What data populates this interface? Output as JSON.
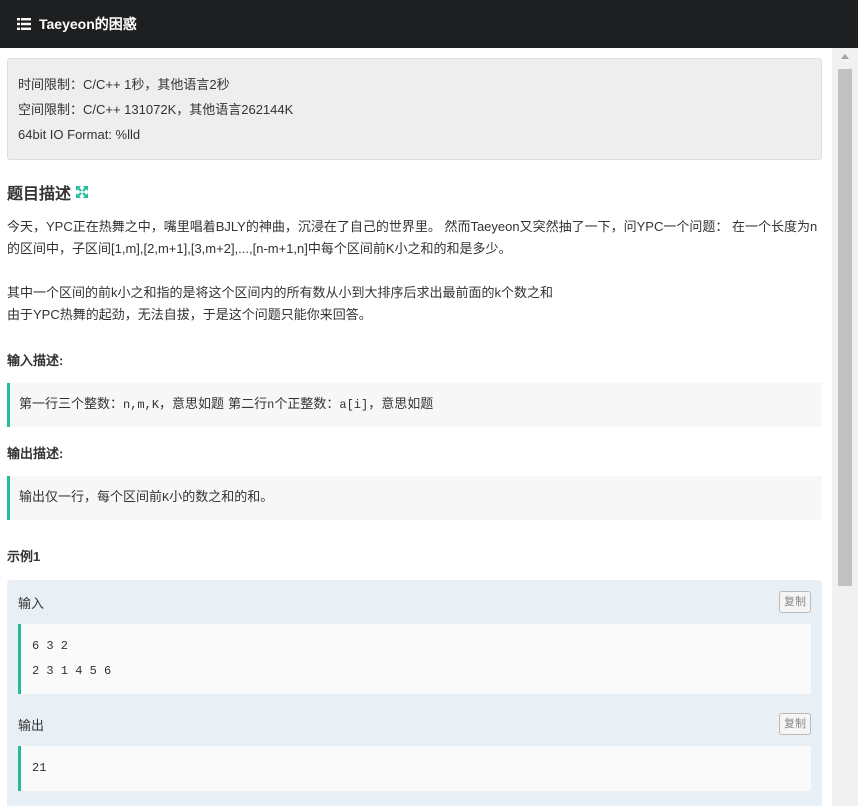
{
  "header": {
    "icon": "list-icon",
    "title": "Taeyeon的困惑"
  },
  "limits": {
    "time": "时间限制：C/C++ 1秒，其他语言2秒",
    "space": "空间限制：C/C++ 131072K，其他语言262144K",
    "format": "64bit IO Format: %lld"
  },
  "problem": {
    "title": "题目描述",
    "expand_icon": "expand-arrows-icon",
    "description_1": "今天，YPC正在热舞之中，嘴里唱着BJLY的神曲，沉浸在了自己的世界里。 然而Taeyeon又突然抽了一下，问YPC一个问题： 在一个长度为n的区间中，子区间[1,m],[2,m+1],[3,m+2],...,[n-m+1,n]中每个区间前K小之和的和是多少。",
    "description_2": "其中一个区间的前k小之和指的是将这个区间内的所有数从小到大排序后求出最前面的k个数之和",
    "description_3": "由于YPC热舞的起劲，无法自拔，于是这个问题只能你来回答。"
  },
  "input_section": {
    "title": "输入描述:",
    "text_a": "第一行三个整数：",
    "code_a": "n,m,K",
    "text_b": "，意思如题 第二行",
    "code_b": "n",
    "text_c": "个正整数：",
    "code_c": "a[i]",
    "text_d": "，意思如题"
  },
  "output_section": {
    "title": "输出描述:",
    "text_a": "输出仅一行，每个区间前",
    "code_a": "K",
    "text_b": "小的数之和的和。"
  },
  "example": {
    "title": "示例1",
    "input_label": "输入",
    "input_copy": "复制",
    "input_lines": [
      "6 3 2",
      "2 3 1 4 5 6"
    ],
    "output_label": "输出",
    "output_copy": "复制",
    "output_lines": [
      "21"
    ]
  },
  "colors": {
    "accent": "#25bb9b",
    "header_bg": "#1d1f21",
    "panel_bg": "#e8eff5"
  }
}
